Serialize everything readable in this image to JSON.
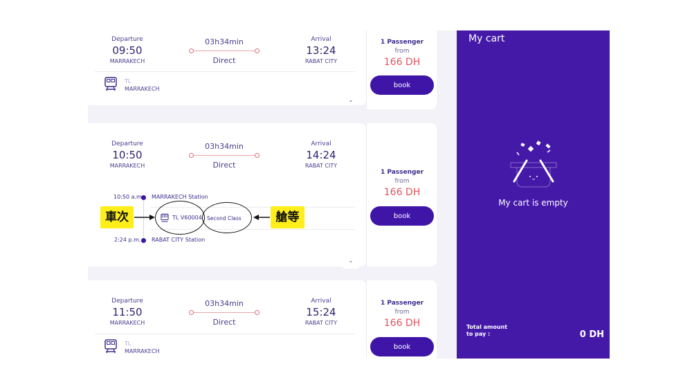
{
  "trips": [
    {
      "departure_label": "Departure",
      "departure_time": "09:50",
      "departure_city": "MARRAKECH",
      "duration": "03h34min",
      "type": "Direct",
      "arrival_label": "Arrival",
      "arrival_time": "13:24",
      "arrival_city": "RABAT CITY",
      "operator": "TL",
      "operator_city": "MARRAKECH",
      "passengers": "1 Passenger",
      "from": "from",
      "price": "166 DH",
      "book": "book",
      "chevron": "chevron-down-icon"
    },
    {
      "departure_label": "Departure",
      "departure_time": "10:50",
      "departure_city": "MARRAKECH",
      "duration": "03h34min",
      "type": "Direct",
      "arrival_label": "Arrival",
      "arrival_time": "14:24",
      "arrival_city": "RABAT CITY",
      "passengers": "1 Passenger",
      "from": "from",
      "price": "166 DH",
      "book": "book",
      "chevron": "chevron-up-icon",
      "details": {
        "start_time": "10:50 a.m.",
        "start_station": "MARRAKECH Station",
        "train": "TL V60004",
        "class": "Second Class",
        "end_time": "2:24 p.m.",
        "end_station": "RABAT CITY Station"
      }
    },
    {
      "departure_label": "Departure",
      "departure_time": "11:50",
      "departure_city": "MARRAKECH",
      "duration": "03h34min",
      "type": "Direct",
      "arrival_label": "Arrival",
      "arrival_time": "15:24",
      "arrival_city": "RABAT CITY",
      "operator": "TL",
      "operator_city": "MARRAKECH",
      "passengers": "1 Passenger",
      "from": "from",
      "price": "166 DH",
      "book": "book"
    }
  ],
  "annotations": {
    "train_number_label": "車次",
    "class_label": "艙等"
  },
  "cart": {
    "title": "My cart",
    "empty_text": "My cart is empty",
    "total_label": "Total amount to pay :",
    "total_value": "0 DH"
  },
  "colors": {
    "brand": "#4519a8",
    "price": "#e2545c",
    "annotation": "#ffee1a"
  }
}
